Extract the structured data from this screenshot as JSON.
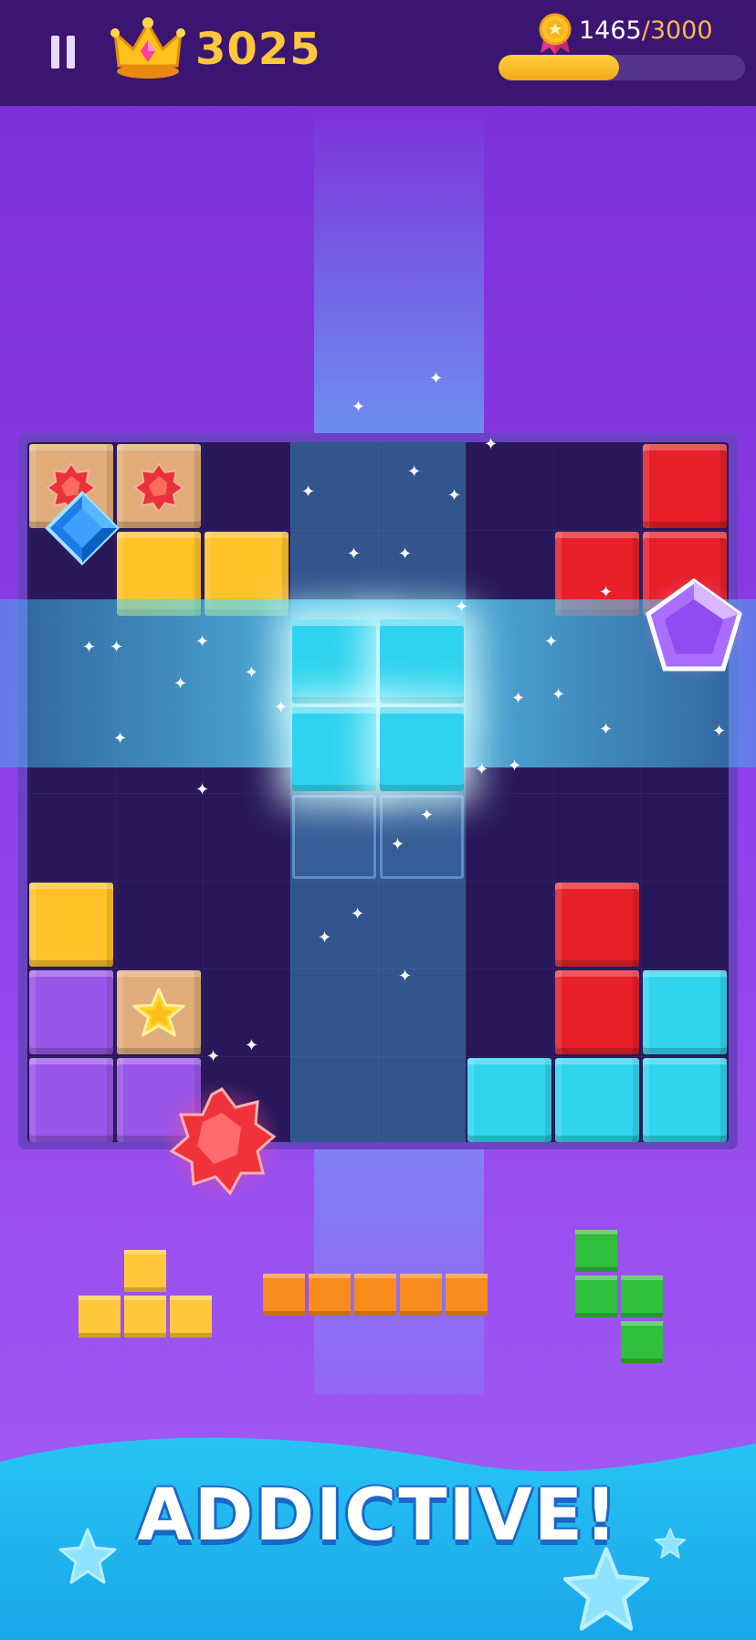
{
  "hud": {
    "score": "3025",
    "progress_current": "1465",
    "progress_separator": "/",
    "progress_target": "3000",
    "progress_fraction": 0.49
  },
  "icons": {
    "pause": "pause-icon",
    "crown": "crown-icon",
    "medal": "medal-icon"
  },
  "colors": {
    "accent_gold": "#ffc83d",
    "yellow_block": "#ffc329",
    "red_block": "#e7202a",
    "purple_block": "#9a56e8",
    "cyan_block": "#31d6ee",
    "tan_block": "#e0ad7a"
  },
  "board": {
    "size": 8,
    "cells": [
      {
        "r": 0,
        "c": 0,
        "color": "tan",
        "gem": "red-star"
      },
      {
        "r": 0,
        "c": 1,
        "color": "tan",
        "gem": "red-star"
      },
      {
        "r": 0,
        "c": 7,
        "color": "red"
      },
      {
        "r": 1,
        "c": 1,
        "color": "yellow"
      },
      {
        "r": 1,
        "c": 2,
        "color": "yellow"
      },
      {
        "r": 1,
        "c": 6,
        "color": "red"
      },
      {
        "r": 1,
        "c": 7,
        "color": "red"
      },
      {
        "r": 2,
        "c": 3,
        "color": "cyan-glow"
      },
      {
        "r": 2,
        "c": 4,
        "color": "cyan-glow"
      },
      {
        "r": 3,
        "c": 3,
        "color": "cyan-glow"
      },
      {
        "r": 3,
        "c": 4,
        "color": "cyan-glow"
      },
      {
        "r": 4,
        "c": 3,
        "color": "ghost"
      },
      {
        "r": 4,
        "c": 4,
        "color": "ghost"
      },
      {
        "r": 5,
        "c": 0,
        "color": "yellow"
      },
      {
        "r": 5,
        "c": 6,
        "color": "red"
      },
      {
        "r": 6,
        "c": 0,
        "color": "purple"
      },
      {
        "r": 6,
        "c": 1,
        "color": "tan",
        "gem": "yellow-star"
      },
      {
        "r": 6,
        "c": 6,
        "color": "red"
      },
      {
        "r": 6,
        "c": 7,
        "color": "cyan"
      },
      {
        "r": 7,
        "c": 0,
        "color": "purple"
      },
      {
        "r": 7,
        "c": 1,
        "color": "purple"
      },
      {
        "r": 7,
        "c": 5,
        "color": "cyan"
      },
      {
        "r": 7,
        "c": 6,
        "color": "cyan"
      },
      {
        "r": 7,
        "c": 7,
        "color": "cyan"
      }
    ]
  },
  "tray": [
    {
      "name": "t-piece",
      "color": "yellow"
    },
    {
      "name": "i-piece-5",
      "color": "orange"
    },
    {
      "name": "s-piece",
      "color": "green"
    }
  ],
  "banner": {
    "headline": "ADDICTIVE!"
  }
}
